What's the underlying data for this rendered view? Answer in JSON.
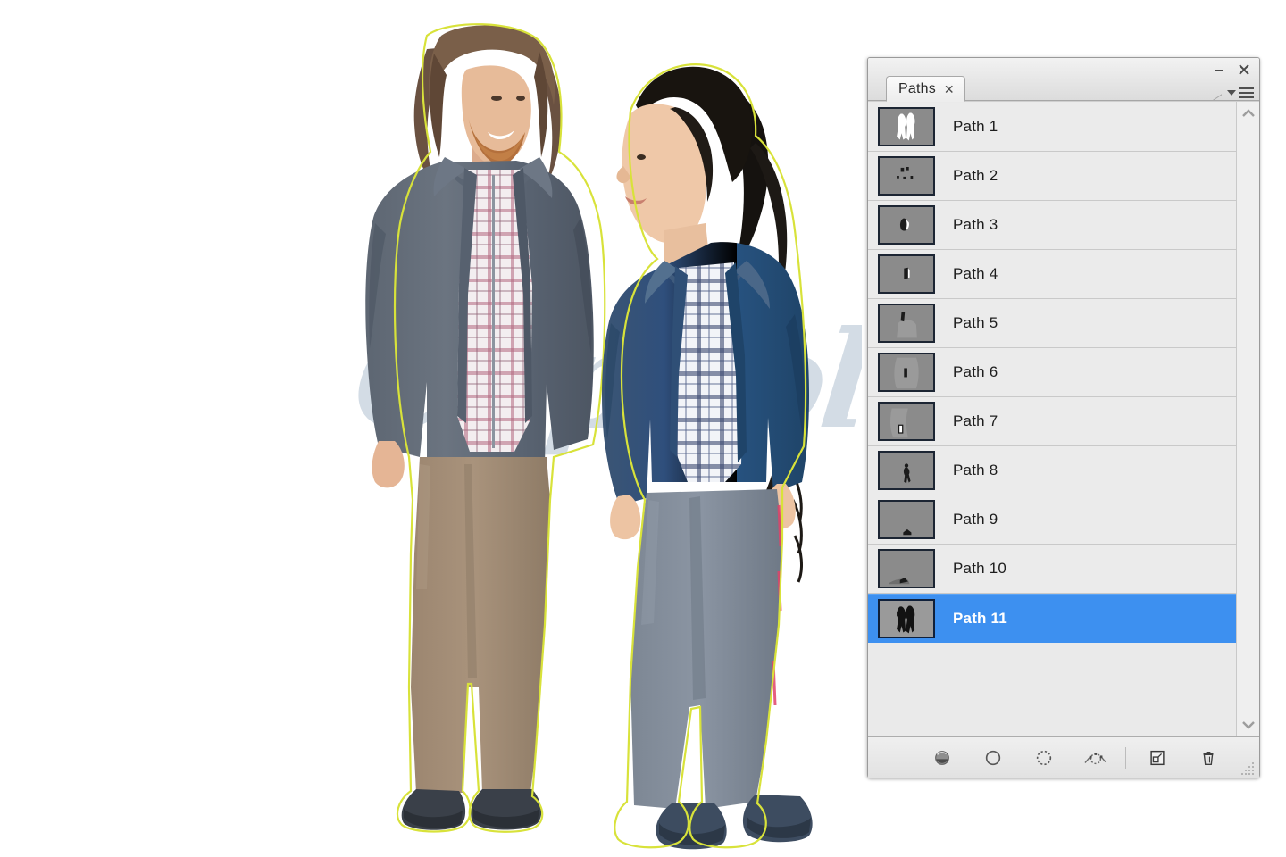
{
  "canvas": {
    "watermark_text": "ClipColor",
    "watermark_color": "#9fb3c6",
    "background_color": "#ffffff",
    "subject_description": "two people wearing zip-up hooded jackets over plaid shirts, with clipping paths outlined",
    "path_outline_color": "#d8e23a"
  },
  "panel": {
    "tab_label": "Paths",
    "tab_close_label": "✕",
    "minimize_label": "–",
    "close_label": "✕",
    "menu_icon": "panel-menu-icon",
    "accent_color": "#3d90f0",
    "background_color": "#e9e9e9",
    "thumbnail_background": "#8b8b8b",
    "scrollbar": {
      "up_arrow": "⌃",
      "down_arrow": "⌄"
    },
    "rows": [
      {
        "label": "Path 1",
        "thumb": "both-figures-silhouette",
        "selected": false
      },
      {
        "label": "Path 2",
        "thumb": "small-fragments",
        "selected": false
      },
      {
        "label": "Path 3",
        "thumb": "hand-fragment",
        "selected": false
      },
      {
        "label": "Path 4",
        "thumb": "small-blob",
        "selected": false
      },
      {
        "label": "Path 5",
        "thumb": "torso-fragment",
        "selected": false
      },
      {
        "label": "Path 6",
        "thumb": "narrow-sliver",
        "selected": false
      },
      {
        "label": "Path 7",
        "thumb": "rectangle-sliver",
        "selected": false
      },
      {
        "label": "Path 8",
        "thumb": "thin-figure",
        "selected": false
      },
      {
        "label": "Path 9",
        "thumb": "bottom-edge-notch",
        "selected": false
      },
      {
        "label": "Path 10",
        "thumb": "bottom-edge-streak",
        "selected": false
      },
      {
        "label": "Path 11",
        "thumb": "both-figures-filled",
        "selected": true
      }
    ],
    "footer_tools": [
      {
        "name": "fill-path-button",
        "icon": "filled-circle-icon"
      },
      {
        "name": "stroke-path-button",
        "icon": "circle-outline-icon"
      },
      {
        "name": "load-selection-button",
        "icon": "dashed-circle-icon"
      },
      {
        "name": "make-work-path-button",
        "icon": "pen-path-icon"
      },
      {
        "name": "new-path-button",
        "icon": "new-page-icon"
      },
      {
        "name": "delete-path-button",
        "icon": "trash-icon"
      }
    ]
  }
}
